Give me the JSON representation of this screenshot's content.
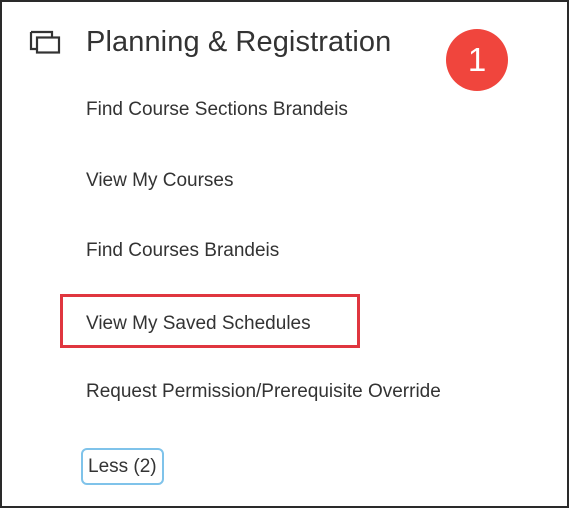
{
  "header": {
    "icon": "stacked-windows-icon",
    "title": "Planning & Registration"
  },
  "badge": {
    "label": "1",
    "color": "#f0453d"
  },
  "menu": {
    "items": [
      {
        "label": "Find Course Sections Brandeis"
      },
      {
        "label": "View My Courses"
      },
      {
        "label": "Find Courses Brandeis"
      },
      {
        "label": "View My Saved Schedules",
        "highlighted": true
      },
      {
        "label": "Request Permission/Prerequisite Override"
      }
    ],
    "toggle_label": "Less (2)"
  },
  "colors": {
    "highlight_border": "#e0363f",
    "toggle_border": "#7fc3ea",
    "text": "#333333"
  }
}
